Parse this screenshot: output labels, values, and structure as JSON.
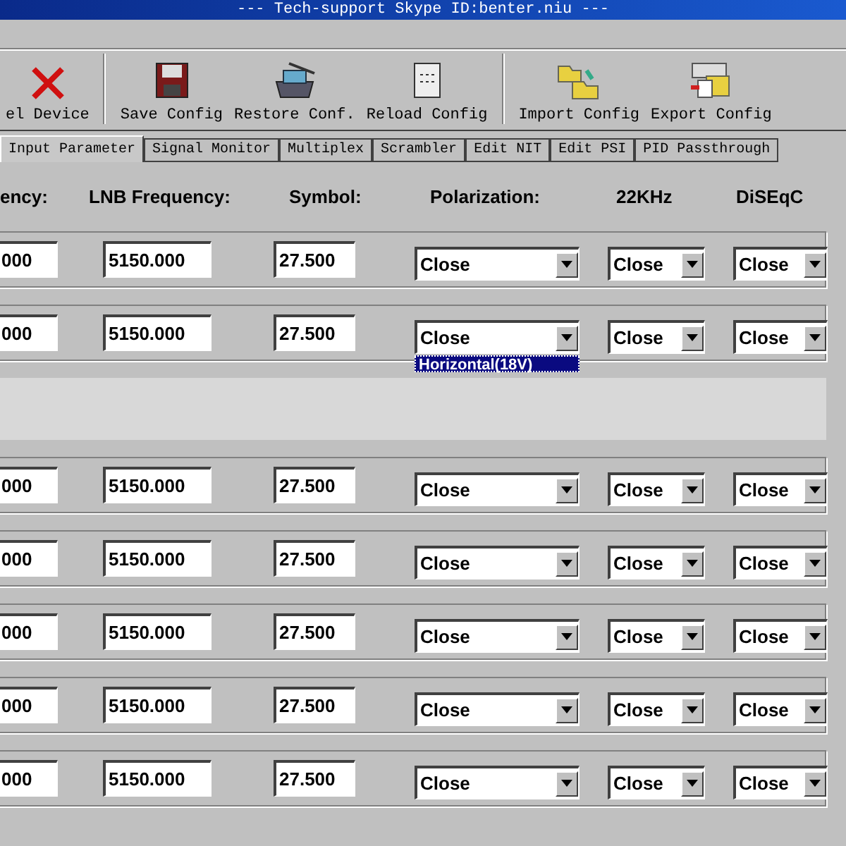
{
  "window": {
    "title": "--- Tech-support Skype ID:benter.niu ---"
  },
  "toolbar": [
    {
      "kind": "delete",
      "label": "el Device"
    },
    {
      "kind": "save",
      "label": "Save Config"
    },
    {
      "kind": "restore",
      "label": "Restore Conf."
    },
    {
      "kind": "reload",
      "label": "Reload Config"
    },
    {
      "kind": "import",
      "label": "Import Config"
    },
    {
      "kind": "export",
      "label": "Export Config"
    }
  ],
  "tabs": [
    {
      "label": "Input Parameter",
      "selected": true
    },
    {
      "label": "Signal Monitor",
      "selected": false
    },
    {
      "label": "Multiplex",
      "selected": false
    },
    {
      "label": "Scrambler",
      "selected": false
    },
    {
      "label": "Edit NIT",
      "selected": false
    },
    {
      "label": "Edit PSI",
      "selected": false
    },
    {
      "label": "PID Passthrough",
      "selected": false
    }
  ],
  "columns": [
    "ency:",
    "LNB Frequency:",
    "Symbol:",
    "Polarization:",
    "22KHz",
    "DiSEqC"
  ],
  "rows": [
    {
      "frequency": "000",
      "lnb": "5150.000",
      "symbol": "27.500",
      "polarization": "Close",
      "khz22": "Close",
      "diseqc": "Close"
    },
    {
      "frequency": "000",
      "lnb": "5150.000",
      "symbol": "27.500",
      "polarization": "Close",
      "khz22": "Close",
      "diseqc": "Close",
      "open_option": "Horizontal(18V)"
    },
    {
      "frequency": "000",
      "lnb": "5150.000",
      "symbol": "27.500",
      "polarization": "Close",
      "khz22": "Close",
      "diseqc": "Close"
    },
    {
      "frequency": "000",
      "lnb": "5150.000",
      "symbol": "27.500",
      "polarization": "Close",
      "khz22": "Close",
      "diseqc": "Close"
    },
    {
      "frequency": "000",
      "lnb": "5150.000",
      "symbol": "27.500",
      "polarization": "Close",
      "khz22": "Close",
      "diseqc": "Close"
    },
    {
      "frequency": "000",
      "lnb": "5150.000",
      "symbol": "27.500",
      "polarization": "Close",
      "khz22": "Close",
      "diseqc": "Close"
    },
    {
      "frequency": "000",
      "lnb": "5150.000",
      "symbol": "27.500",
      "polarization": "Close",
      "khz22": "Close",
      "diseqc": "Close"
    }
  ]
}
